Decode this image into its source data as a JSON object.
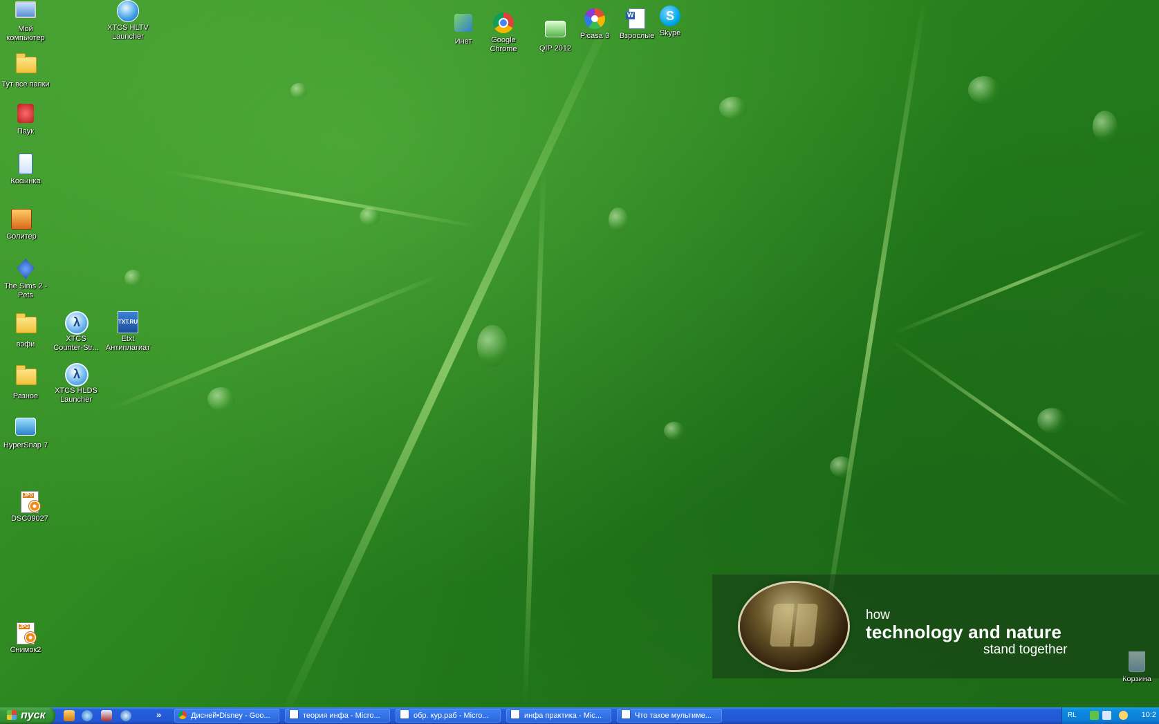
{
  "desktop": {
    "icons": [
      {
        "label": "Мой компьютер"
      },
      {
        "label": "XTCS HLTV Launcher"
      },
      {
        "label": "Тут все папки"
      },
      {
        "label": "Паук"
      },
      {
        "label": "Косынка"
      },
      {
        "label": "Солитер"
      },
      {
        "label": "The Sims 2 - Pets"
      },
      {
        "label": "вэфи"
      },
      {
        "label": "XTCS Counter-Str..."
      },
      {
        "label": "Etxt Антиплагиат"
      },
      {
        "label": "Разное"
      },
      {
        "label": "XTCS HLDS Launcher"
      },
      {
        "label": "HyperSnap 7"
      },
      {
        "label": "DSC09027"
      },
      {
        "label": "Снимок2"
      },
      {
        "label": "Инет"
      },
      {
        "label": "Google Chrome"
      },
      {
        "label": "QIP 2012"
      },
      {
        "label": "Picasa 3"
      },
      {
        "label": "Взрослые"
      },
      {
        "label": "Skype"
      },
      {
        "label": "Корзина"
      }
    ],
    "banner": {
      "line1": "how",
      "line2": "technology and nature",
      "line3": "stand together"
    }
  },
  "taskbar": {
    "start_label": "пуск",
    "more": "»",
    "tasks": [
      {
        "label": "Дисней•Disney - Goo..."
      },
      {
        "label": "теория инфа - Micro..."
      },
      {
        "label": "обр. кур.раб - Micro..."
      },
      {
        "label": "инфа практика - Mic..."
      },
      {
        "label": "Что такое мультиме..."
      }
    ],
    "tray": {
      "lang": "RL",
      "clock": "10:2"
    }
  }
}
